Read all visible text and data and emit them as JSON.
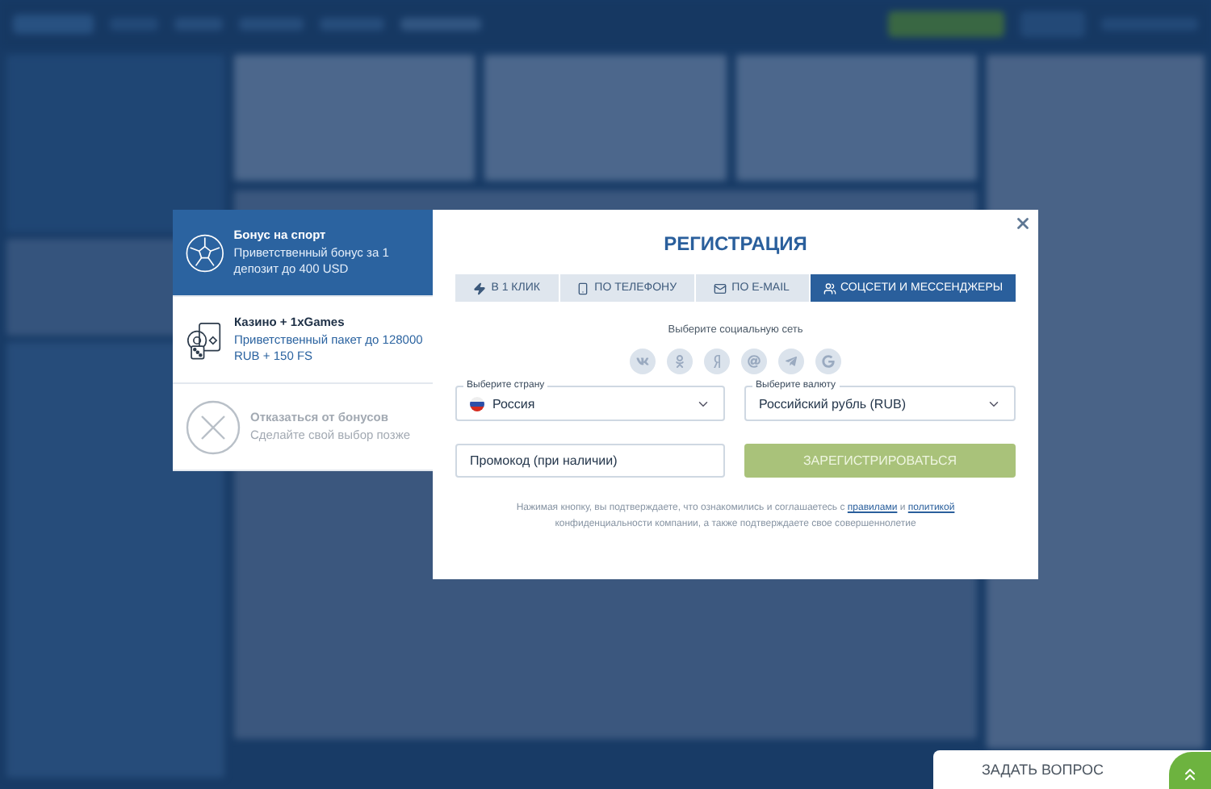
{
  "bonus_options": [
    {
      "kind": "sport",
      "title": "Бонус на спорт",
      "description": "Приветственный бонус за 1 депозит до 400 USD",
      "selected": true
    },
    {
      "kind": "casino",
      "title": "Казино + 1xGames",
      "description": "Приветственный пакет до 128000 RUB + 150 FS",
      "selected": false
    },
    {
      "kind": "decline",
      "title": "Отказаться от бонусов",
      "description": "Сделайте свой выбор позже",
      "selected": false
    }
  ],
  "dialog": {
    "title": "РЕГИСТРАЦИЯ",
    "tabs": [
      {
        "kind": "bolt",
        "label": "В 1 КЛИК",
        "selected": false
      },
      {
        "kind": "phone",
        "label": "ПО ТЕЛЕФОНУ",
        "selected": false
      },
      {
        "kind": "mail",
        "label": "ПО E-MAIL",
        "selected": false
      },
      {
        "kind": "people",
        "label": "СОЦСЕТИ И МЕССЕНДЖЕРЫ",
        "selected": true
      }
    ],
    "social_prompt": "Выберите социальную сеть",
    "social_networks": [
      {
        "kind": "vk"
      },
      {
        "kind": "ok"
      },
      {
        "kind": "yandex"
      },
      {
        "kind": "mail"
      },
      {
        "kind": "telegram"
      },
      {
        "kind": "google"
      }
    ],
    "country": {
      "label": "Выберите страну",
      "value": "Россия"
    },
    "currency": {
      "label": "Выберите валюту",
      "value": "Российский рубль (RUB)"
    },
    "promo": {
      "placeholder": "Промокод (при наличии)"
    },
    "submit": "ЗАРЕГИСТРИРОВАТЬСЯ",
    "legal": {
      "before": "Нажимая кнопку, вы подтверждаете, что ознакомились и соглашаетесь с",
      "rules_link": "правилами",
      "between": "и",
      "policy_link": "политикой",
      "after": "конфиденциальности компании, а также подтверждаете свое совершеннолетие"
    }
  },
  "ask_question": {
    "label": "ЗАДАТЬ ВОПРОС"
  }
}
